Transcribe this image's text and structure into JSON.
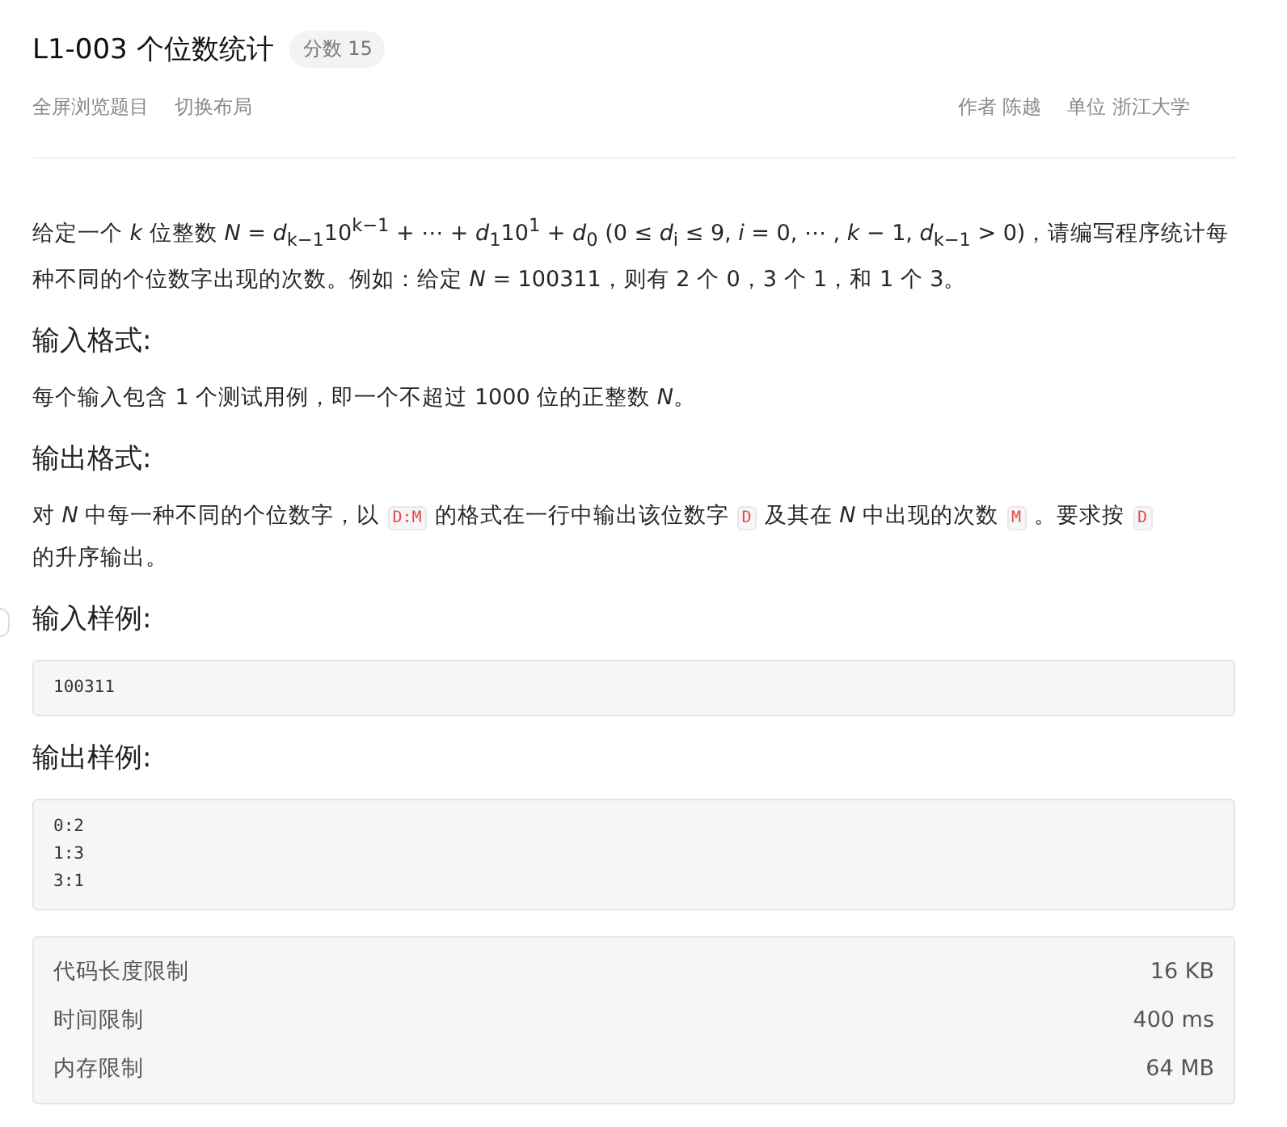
{
  "problem": {
    "title": "L1-003 个位数统计",
    "score_badge": "分数 15"
  },
  "actions": [
    "全屏浏览题目",
    "切换布局"
  ],
  "meta": [
    {
      "label": "作者",
      "value": "陈越"
    },
    {
      "label": "单位",
      "value": "浙江大学"
    }
  ],
  "description": "给定一个 *k* 位整数 *N* = *d*$_{k−1}$10$^{k−1}$ + ⋯ + *d*$_{1}$10$^{1}$ + *d*$_{0}$ (0 ≤ *d*$_{i}$ ≤ 9, *i* = 0, ⋯ , *k* − 1, *d*$_{k−1}$ > 0)，请编写程序统计每种不同的个位数字出现的次数。例如：给定 *N* = 100311，则有 2 个 0，3 个 1，和 1 个 3。",
  "sections": [
    {
      "heading": "输入格式:",
      "parts": [
        {
          "kind": "text",
          "text": "每个输入包含 1 个测试用例，即一个不超过 1000 位的正整数 *N*。"
        }
      ]
    },
    {
      "heading": "输出格式:",
      "parts": [
        {
          "kind": "text",
          "text": "对 *N* 中每一种不同的个位数字，以"
        },
        {
          "kind": "code",
          "text": "D:M"
        },
        {
          "kind": "text",
          "text": "的格式在一行中输出该位数字"
        },
        {
          "kind": "code",
          "text": "D"
        },
        {
          "kind": "text",
          "text": "及其在 *N* 中出现的次数"
        },
        {
          "kind": "code",
          "text": "M"
        },
        {
          "kind": "text",
          "text": "。要求按"
        },
        {
          "kind": "code",
          "text": "D"
        },
        {
          "kind": "text",
          "text": "的升序输出。"
        }
      ]
    },
    {
      "heading": "输入样例:",
      "sample": [
        "100311"
      ]
    },
    {
      "heading": "输出样例:",
      "sample": [
        "0:2",
        "1:3",
        "3:1"
      ]
    }
  ],
  "limits": [
    {
      "label": "代码长度限制",
      "value": "16 KB"
    },
    {
      "label": "时间限制",
      "value": "400 ms"
    },
    {
      "label": "内存限制",
      "value": "64 MB"
    }
  ]
}
